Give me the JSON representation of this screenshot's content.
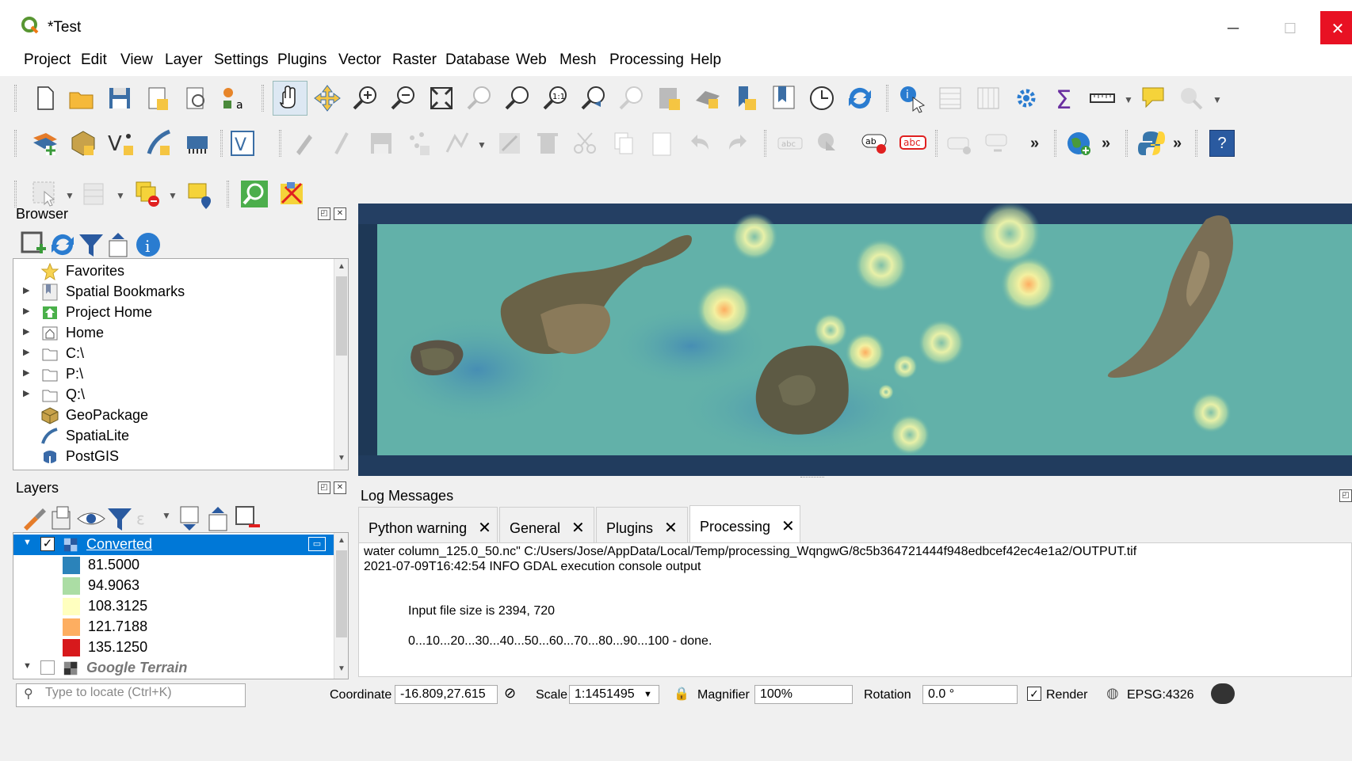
{
  "window": {
    "title": "*Test",
    "minimize": "─",
    "maximize": "☐",
    "close": "✕"
  },
  "menu": [
    "Project",
    "Edit",
    "View",
    "Layer",
    "Settings",
    "Plugins",
    "Vector",
    "Raster",
    "Database",
    "Web",
    "Mesh",
    "Processing",
    "Help"
  ],
  "toolbar": {
    "more": "»"
  },
  "browser": {
    "title": "Browser",
    "items": [
      {
        "label": "Favorites",
        "icon": "star-icon",
        "expandable": false
      },
      {
        "label": "Spatial Bookmarks",
        "icon": "bookmark-icon",
        "expandable": true
      },
      {
        "label": "Project Home",
        "icon": "project-home-icon",
        "expandable": true
      },
      {
        "label": "Home",
        "icon": "home-icon",
        "expandable": true
      },
      {
        "label": "C:\\",
        "icon": "folder-icon",
        "expandable": true
      },
      {
        "label": "P:\\",
        "icon": "folder-icon",
        "expandable": true
      },
      {
        "label": "Q:\\",
        "icon": "folder-icon",
        "expandable": true
      },
      {
        "label": "GeoPackage",
        "icon": "geopackage-icon",
        "expandable": false
      },
      {
        "label": "SpatiaLite",
        "icon": "spatialite-icon",
        "expandable": false
      },
      {
        "label": "PostGIS",
        "icon": "postgis-icon",
        "expandable": false
      }
    ]
  },
  "layers": {
    "title": "Layers",
    "items": [
      {
        "label": "Converted",
        "checked": true,
        "selected": true
      },
      {
        "label": "Google Terrain",
        "checked": false,
        "selected": false
      }
    ],
    "legend": [
      {
        "value": "81.5000",
        "color": "#2b83ba"
      },
      {
        "value": "94.9063",
        "color": "#abdda4"
      },
      {
        "value": "108.3125",
        "color": "#ffffbf"
      },
      {
        "value": "121.7188",
        "color": "#fdae61"
      },
      {
        "value": "135.1250",
        "color": "#d7191c"
      }
    ]
  },
  "log": {
    "title": "Log Messages",
    "tabs": [
      "Python warning",
      "General",
      "Plugins",
      "Processing"
    ],
    "active_tab": "Processing",
    "lines": [
      "water column_125.0_50.nc\" C:/Users/Jose/AppData/Local/Temp/processing_WqngwG/8c5b364721444f948edbcef42ec4e1a2/OUTPUT.tif",
      "2021-07-09T16:42:54    INFO    GDAL execution console output",
      "Input file size is 2394, 720",
      "0...10...20...30...40...50...60...70...80...90...100 - done."
    ]
  },
  "status": {
    "locate_placeholder": "Type to locate (Ctrl+K)",
    "coordinate_label": "Coordinate",
    "coordinate_value": "-16.809,27.615",
    "scale_label": "Scale",
    "scale_value": "1:1451495",
    "magnifier_label": "Magnifier",
    "magnifier_value": "100%",
    "rotation_label": "Rotation",
    "rotation_value": "0.0 °",
    "render_label": "Render",
    "crs": "EPSG:4326"
  }
}
